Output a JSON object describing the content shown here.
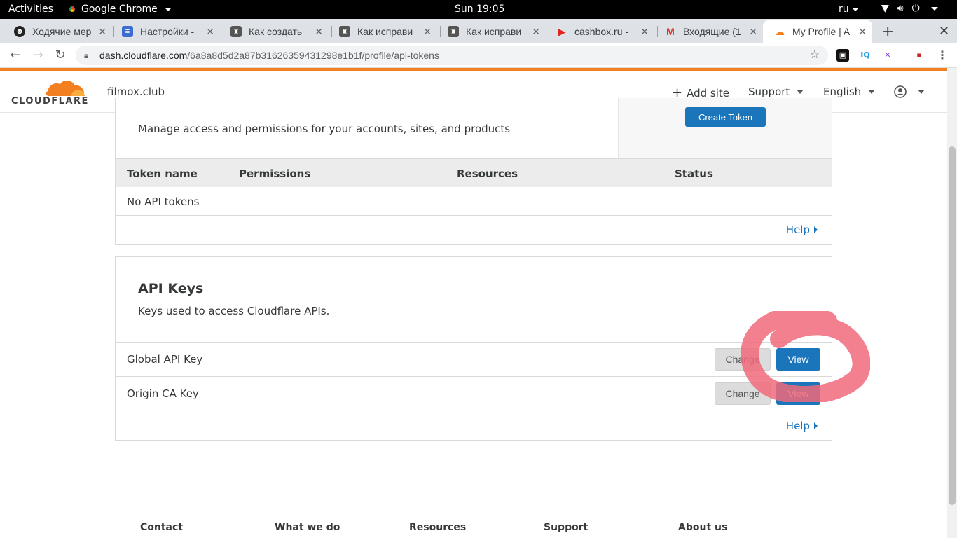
{
  "gnome": {
    "activities": "Activities",
    "app_name": "Google Chrome",
    "clock": "Sun 19:05",
    "language": "ru"
  },
  "tabs": [
    {
      "label": "Ходячие мер",
      "icon": "avatar-icon"
    },
    {
      "label": "Настройки -",
      "icon": "database-icon"
    },
    {
      "label": "Как создать",
      "icon": "robot-icon"
    },
    {
      "label": "Как исправи",
      "icon": "robot-icon"
    },
    {
      "label": "Как исправи",
      "icon": "robot-icon"
    },
    {
      "label": "cashbox.ru -",
      "icon": "youtube-icon"
    },
    {
      "label": "Входящие (1",
      "icon": "gmail-icon"
    },
    {
      "label": "My Profile | A",
      "icon": "cloudflare-icon"
    }
  ],
  "omnibox": {
    "host": "dash.cloudflare.com",
    "path": "/6a8a8d5d2a87b31626359431298e1b1f/profile/api-tokens"
  },
  "header": {
    "logo_text": "CLOUDFLARE",
    "site": "filmox.club",
    "add_site": "Add site",
    "support": "Support",
    "language": "English"
  },
  "tokens": {
    "create_button": "Create Token",
    "description": "Manage access and permissions for your accounts, sites, and products",
    "columns": [
      "Token name",
      "Permissions",
      "Resources",
      "Status"
    ],
    "empty": "No API tokens",
    "help": "Help"
  },
  "api_keys": {
    "title": "API Keys",
    "description": "Keys used to access Cloudflare APIs.",
    "rows": [
      {
        "label": "Global API Key",
        "change": "Change",
        "view": "View"
      },
      {
        "label": "Origin CA Key",
        "change": "Change",
        "view": "View"
      }
    ],
    "help": "Help"
  },
  "footer": {
    "columns": [
      "Contact",
      "What we do",
      "Resources",
      "Support",
      "About us"
    ]
  },
  "colors": {
    "accent": "#f38020",
    "primary_button": "#1b75bb",
    "annotation": "#f06a7a"
  }
}
